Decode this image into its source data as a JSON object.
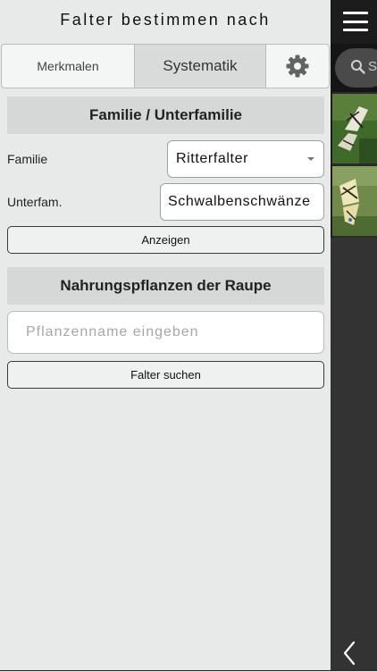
{
  "panel": {
    "title": "Falter bestimmen nach",
    "tabs": [
      {
        "label": "Merkmalen"
      },
      {
        "label": "Systematik",
        "selected": true
      },
      {
        "icon": "gear-icon"
      }
    ],
    "familie_section": {
      "header": "Familie / Unterfamilie",
      "familie_label": "Familie",
      "familie_value": "Ritterfalter",
      "unterfamilie_label": "Unterfam.",
      "unterfamilie_value": "Schwalbenschwänze",
      "show_button": "Anzeigen"
    },
    "pflanzen_section": {
      "header": "Nahrungspflanzen der Raupe",
      "input_placeholder": "Pflanzenname eingeben",
      "input_value": "",
      "search_button": "Falter suchen"
    }
  },
  "background_screen": {
    "menu_icon": "hamburger-menu-icon",
    "search_icon": "search-icon",
    "search_partial_text": "S",
    "thumbnails": [
      "butterfly-photo-1",
      "butterfly-photo-2"
    ],
    "back_icon": "chevron-left-icon"
  },
  "colors": {
    "panel_background": "#e8eaea",
    "section_header_bg": "#d6d8d8",
    "selected_tab_bg": "#d9dbdb",
    "dark_background": "#2b2b2b"
  }
}
